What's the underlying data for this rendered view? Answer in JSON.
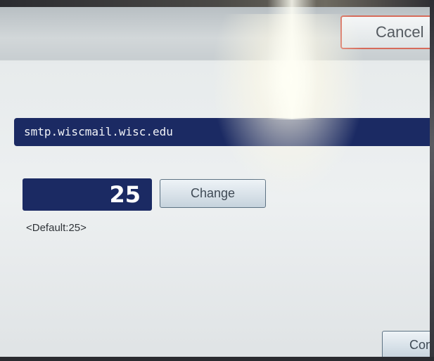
{
  "header": {
    "cancel_label": "Cancel"
  },
  "settings": {
    "server_value": "smtp.wiscmail.wisc.edu",
    "port_value": "25",
    "change_label": "Change",
    "default_label": "<Default:25>"
  },
  "footer": {
    "confirm_label_visible": "Con"
  },
  "colors": {
    "field_background": "#1b2a63",
    "cancel_border": "#d66a5a",
    "screen_background": "#edf0f1"
  }
}
